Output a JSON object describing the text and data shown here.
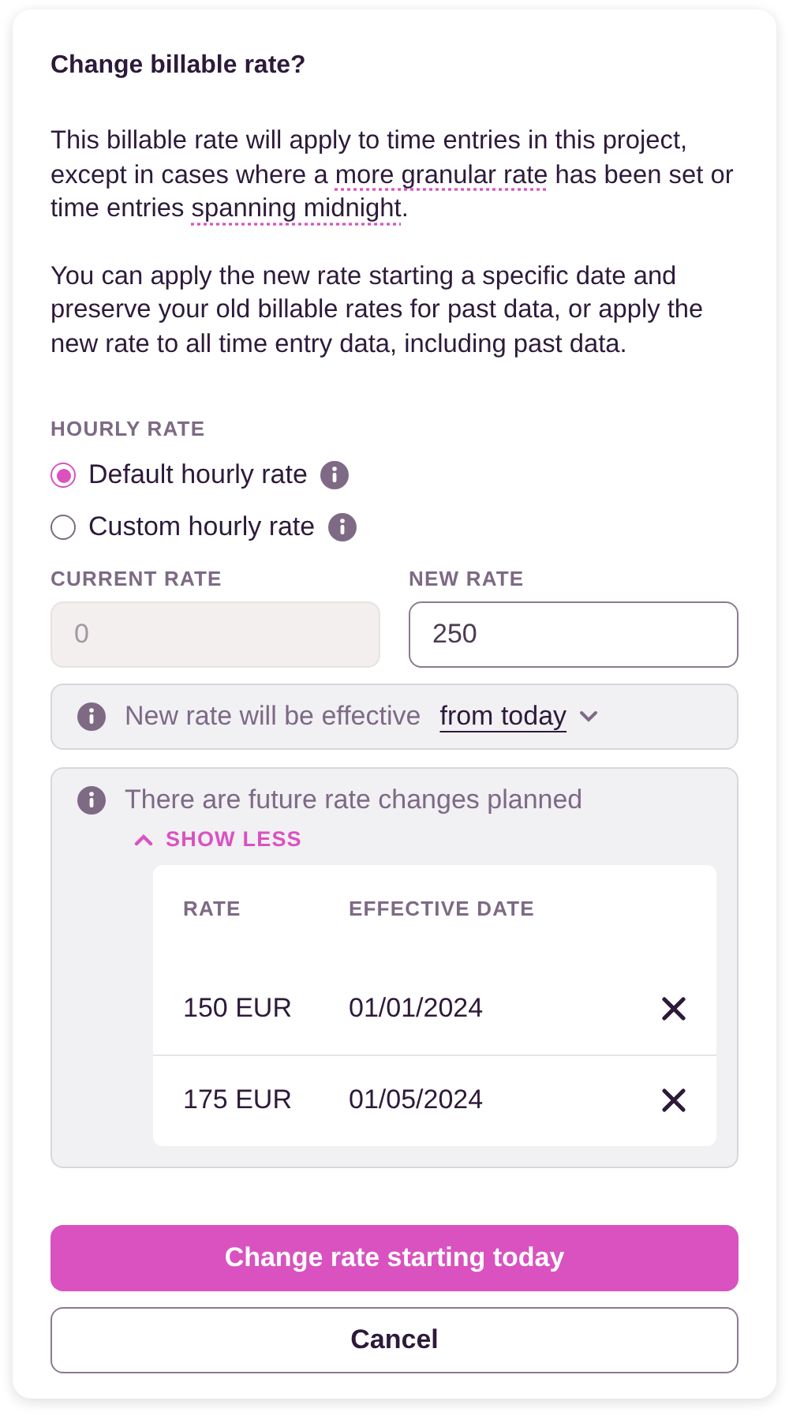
{
  "dialog": {
    "title": "Change billable rate?"
  },
  "intro": [
    {
      "kind": "text",
      "text": "This billable rate will apply to time entries in this project, except in cases where a "
    },
    {
      "kind": "link",
      "text": "more granular rate"
    },
    {
      "kind": "text",
      "text": " has been set or time entries "
    },
    {
      "kind": "link",
      "text": "spanning midnight"
    },
    {
      "kind": "text",
      "text": "."
    }
  ],
  "explanation": "You can apply the new rate starting a specific date and preserve your old billable rates for past data, or apply the new rate to all time entry data, including past data.",
  "rate_type": {
    "label": "HOURLY RATE",
    "options": [
      {
        "label": "Default hourly rate",
        "selected": true
      },
      {
        "label": "Custom hourly rate",
        "selected": false
      }
    ]
  },
  "current_rate": {
    "label": "CURRENT RATE",
    "placeholder": "0",
    "disabled": true
  },
  "new_rate": {
    "label": "NEW RATE",
    "value": "250"
  },
  "effective": {
    "text": "New rate will be effective",
    "option": "from today"
  },
  "future_changes": {
    "text": "There are future rate changes planned",
    "toggle": "SHOW LESS",
    "expanded": true,
    "columns": [
      "RATE",
      "EFFECTIVE DATE"
    ],
    "rows": [
      {
        "rate": "150 EUR",
        "date": "01/01/2024"
      },
      {
        "rate": "175 EUR",
        "date": "01/05/2024"
      }
    ]
  },
  "buttons": {
    "primary": "Change rate starting today",
    "cancel": "Cancel"
  }
}
